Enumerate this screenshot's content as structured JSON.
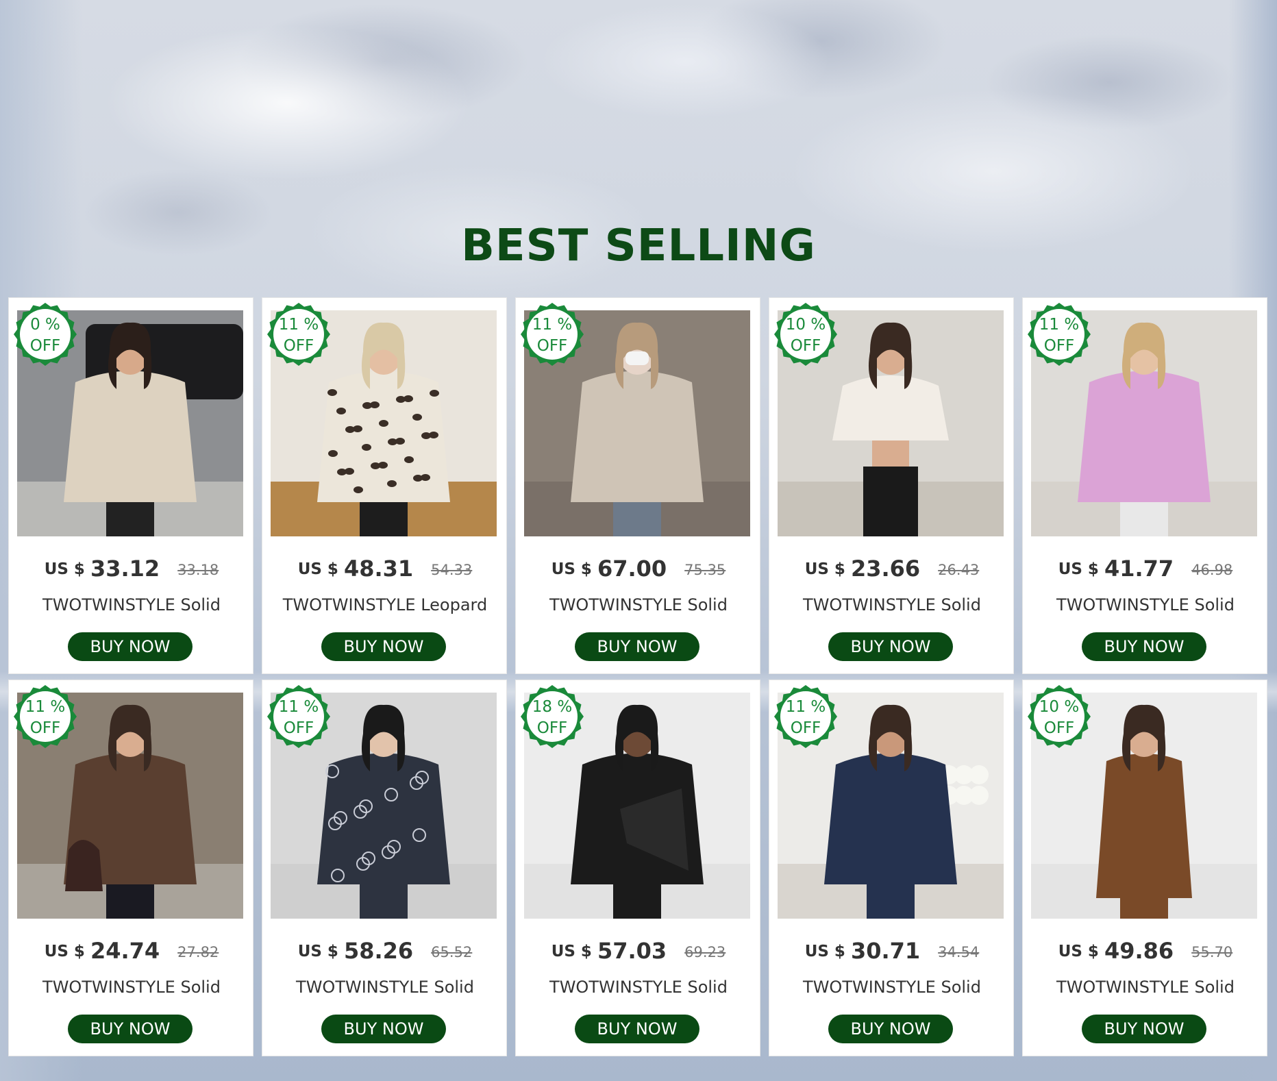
{
  "section_title": "BEST SELLING",
  "colors": {
    "title": "#0d4a16",
    "button_bg": "#0a4a14",
    "badge": "#1a8a3a"
  },
  "currency_label": "US $",
  "badge_suffix": "OFF",
  "button_label": "BUY NOW",
  "products": [
    {
      "discount": "0 %",
      "price": "33.12",
      "original": "33.18",
      "name": "TWOTWINSTYLE Solid",
      "image": "woman in beige faux fur coat"
    },
    {
      "discount": "11 %",
      "price": "48.31",
      "original": "54.33",
      "name": "TWOTWINSTYLE Leopard",
      "image": "woman in leopard print fur coat"
    },
    {
      "discount": "11 %",
      "price": "67.00",
      "original": "75.35",
      "name": "TWOTWINSTYLE Solid",
      "image": "woman in grey fur coat with mask"
    },
    {
      "discount": "10 %",
      "price": "23.66",
      "original": "26.43",
      "name": "TWOTWINSTYLE Solid",
      "image": "woman in cropped white fur jacket"
    },
    {
      "discount": "11 %",
      "price": "41.77",
      "original": "46.98",
      "name": "TWOTWINSTYLE Solid",
      "image": "woman in pink blazer"
    },
    {
      "discount": "11 %",
      "price": "24.74",
      "original": "27.82",
      "name": "TWOTWINSTYLE Solid",
      "image": "woman in brown short coat"
    },
    {
      "discount": "11 %",
      "price": "58.26",
      "original": "65.52",
      "name": "TWOTWINSTYLE Solid",
      "image": "woman in sequined dark coat"
    },
    {
      "discount": "18 %",
      "price": "57.03",
      "original": "69.23",
      "name": "TWOTWINSTYLE Solid",
      "image": "woman in black blazer with bow"
    },
    {
      "discount": "11 %",
      "price": "30.71",
      "original": "34.54",
      "name": "TWOTWINSTYLE Solid",
      "image": "woman in navy belted blazer"
    },
    {
      "discount": "10 %",
      "price": "49.86",
      "original": "55.70",
      "name": "TWOTWINSTYLE Solid",
      "image": "woman in brown suede trench coat"
    }
  ]
}
